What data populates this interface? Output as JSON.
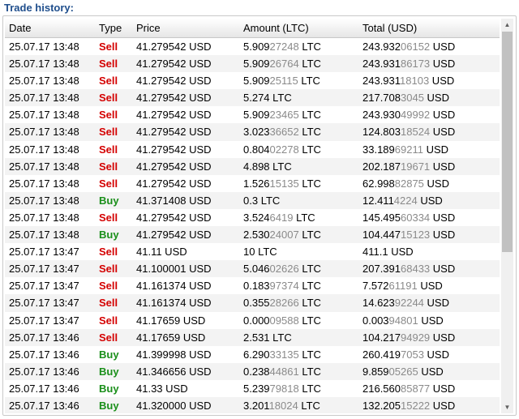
{
  "panel": {
    "title": "Trade history:"
  },
  "table": {
    "columns": [
      "Date",
      "Type",
      "Price",
      "Amount (LTC)",
      "Total (USD)"
    ],
    "rows": [
      {
        "date": "25.07.17 13:48",
        "type": "Sell",
        "price": "41.279542 USD",
        "amount_main": "5.909",
        "amount_tail": "27248",
        "amount_unit": " LTC",
        "total_main": "243.932",
        "total_tail": "06152",
        "total_unit": " USD"
      },
      {
        "date": "25.07.17 13:48",
        "type": "Sell",
        "price": "41.279542 USD",
        "amount_main": "5.909",
        "amount_tail": "26764",
        "amount_unit": " LTC",
        "total_main": "243.931",
        "total_tail": "86173",
        "total_unit": " USD"
      },
      {
        "date": "25.07.17 13:48",
        "type": "Sell",
        "price": "41.279542 USD",
        "amount_main": "5.909",
        "amount_tail": "25115",
        "amount_unit": " LTC",
        "total_main": "243.931",
        "total_tail": "18103",
        "total_unit": " USD"
      },
      {
        "date": "25.07.17 13:48",
        "type": "Sell",
        "price": "41.279542 USD",
        "amount_main": "5.274",
        "amount_tail": "",
        "amount_unit": " LTC",
        "total_main": "217.708",
        "total_tail": "3045",
        "total_unit": " USD"
      },
      {
        "date": "25.07.17 13:48",
        "type": "Sell",
        "price": "41.279542 USD",
        "amount_main": "5.909",
        "amount_tail": "23465",
        "amount_unit": " LTC",
        "total_main": "243.930",
        "total_tail": "49992",
        "total_unit": " USD"
      },
      {
        "date": "25.07.17 13:48",
        "type": "Sell",
        "price": "41.279542 USD",
        "amount_main": "3.023",
        "amount_tail": "36652",
        "amount_unit": " LTC",
        "total_main": "124.803",
        "total_tail": "18524",
        "total_unit": " USD"
      },
      {
        "date": "25.07.17 13:48",
        "type": "Sell",
        "price": "41.279542 USD",
        "amount_main": "0.804",
        "amount_tail": "02278",
        "amount_unit": " LTC",
        "total_main": "33.189",
        "total_tail": "69211",
        "total_unit": " USD"
      },
      {
        "date": "25.07.17 13:48",
        "type": "Sell",
        "price": "41.279542 USD",
        "amount_main": "4.898",
        "amount_tail": "",
        "amount_unit": " LTC",
        "total_main": "202.187",
        "total_tail": "19671",
        "total_unit": " USD"
      },
      {
        "date": "25.07.17 13:48",
        "type": "Sell",
        "price": "41.279542 USD",
        "amount_main": "1.526",
        "amount_tail": "15135",
        "amount_unit": " LTC",
        "total_main": "62.998",
        "total_tail": "82875",
        "total_unit": " USD"
      },
      {
        "date": "25.07.17 13:48",
        "type": "Buy",
        "price": "41.371408 USD",
        "amount_main": "0.3",
        "amount_tail": "",
        "amount_unit": " LTC",
        "total_main": "12.411",
        "total_tail": "4224",
        "total_unit": " USD"
      },
      {
        "date": "25.07.17 13:48",
        "type": "Sell",
        "price": "41.279542 USD",
        "amount_main": "3.524",
        "amount_tail": "6419",
        "amount_unit": " LTC",
        "total_main": "145.495",
        "total_tail": "60334",
        "total_unit": " USD"
      },
      {
        "date": "25.07.17 13:48",
        "type": "Buy",
        "price": "41.279542 USD",
        "amount_main": "2.530",
        "amount_tail": "24007",
        "amount_unit": " LTC",
        "total_main": "104.447",
        "total_tail": "15123",
        "total_unit": " USD"
      },
      {
        "date": "25.07.17 13:47",
        "type": "Sell",
        "price": "41.11 USD",
        "amount_main": "10",
        "amount_tail": "",
        "amount_unit": " LTC",
        "total_main": "411.1",
        "total_tail": "",
        "total_unit": " USD"
      },
      {
        "date": "25.07.17 13:47",
        "type": "Sell",
        "price": "41.100001 USD",
        "amount_main": "5.046",
        "amount_tail": "02626",
        "amount_unit": " LTC",
        "total_main": "207.391",
        "total_tail": "68433",
        "total_unit": " USD"
      },
      {
        "date": "25.07.17 13:47",
        "type": "Sell",
        "price": "41.161374 USD",
        "amount_main": "0.183",
        "amount_tail": "97374",
        "amount_unit": " LTC",
        "total_main": "7.572",
        "total_tail": "61191",
        "total_unit": " USD"
      },
      {
        "date": "25.07.17 13:47",
        "type": "Sell",
        "price": "41.161374 USD",
        "amount_main": "0.355",
        "amount_tail": "28266",
        "amount_unit": " LTC",
        "total_main": "14.623",
        "total_tail": "92244",
        "total_unit": " USD"
      },
      {
        "date": "25.07.17 13:47",
        "type": "Sell",
        "price": "41.17659 USD",
        "amount_main": "0.000",
        "amount_tail": "09588",
        "amount_unit": " LTC",
        "total_main": "0.003",
        "total_tail": "94801",
        "total_unit": " USD"
      },
      {
        "date": "25.07.17 13:46",
        "type": "Sell",
        "price": "41.17659 USD",
        "amount_main": "2.531",
        "amount_tail": "",
        "amount_unit": " LTC",
        "total_main": "104.217",
        "total_tail": "94929",
        "total_unit": " USD"
      },
      {
        "date": "25.07.17 13:46",
        "type": "Buy",
        "price": "41.399998 USD",
        "amount_main": "6.290",
        "amount_tail": "33135",
        "amount_unit": " LTC",
        "total_main": "260.419",
        "total_tail": "7053",
        "total_unit": " USD"
      },
      {
        "date": "25.07.17 13:46",
        "type": "Buy",
        "price": "41.346656 USD",
        "amount_main": "0.238",
        "amount_tail": "44861",
        "amount_unit": " LTC",
        "total_main": "9.859",
        "total_tail": "05265",
        "total_unit": " USD"
      },
      {
        "date": "25.07.17 13:46",
        "type": "Buy",
        "price": "41.33 USD",
        "amount_main": "5.239",
        "amount_tail": "79818",
        "amount_unit": " LTC",
        "total_main": "216.560",
        "total_tail": "85877",
        "total_unit": " USD"
      },
      {
        "date": "25.07.17 13:46",
        "type": "Buy",
        "price": "41.320000 USD",
        "amount_main": "3.201",
        "amount_tail": "18024",
        "amount_unit": " LTC",
        "total_main": "132.205",
        "total_tail": "15222",
        "total_unit": " USD"
      }
    ]
  },
  "colors": {
    "sell": "#d40000",
    "buy": "#1a8f1a",
    "muted": "#8a8a8a",
    "title": "#1f4e8c"
  }
}
